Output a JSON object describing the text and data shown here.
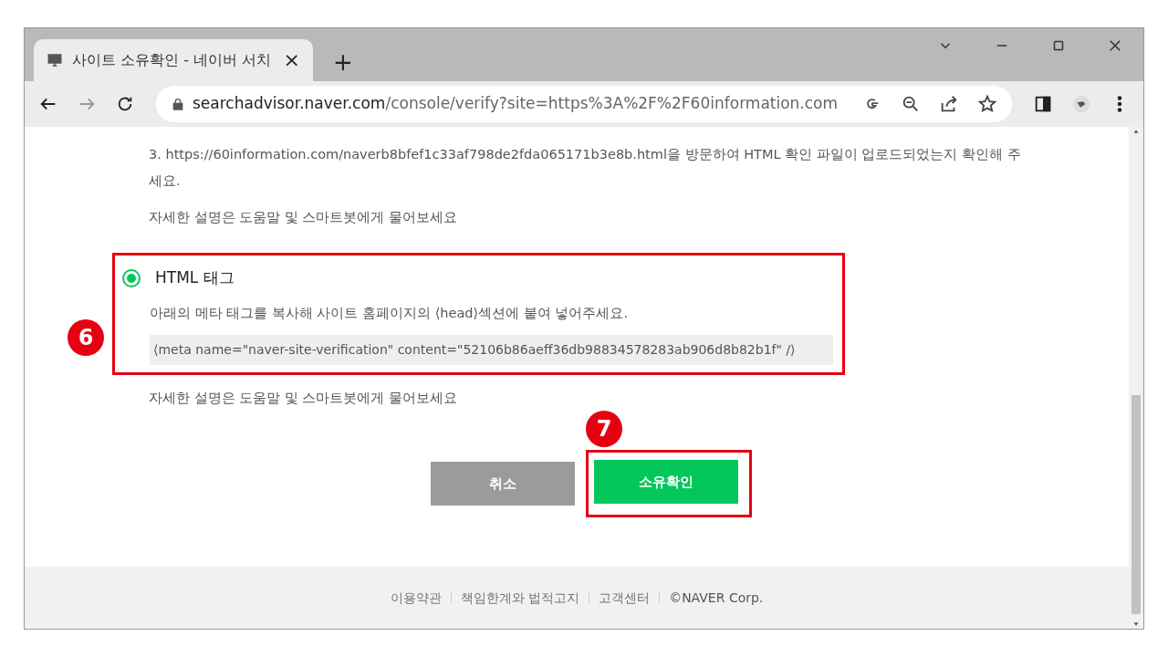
{
  "browser": {
    "tab": {
      "title": "사이트 소유확인 - 네이버 서치",
      "close": "×"
    },
    "new_tab": "+",
    "address": {
      "host": "searchadvisor.naver.com",
      "path": "/console/verify?site=https%3A%2F%2F60information.com"
    },
    "forward_disabled": true
  },
  "step": "3. https://60information.com/naverb8bfef1c33af798de2fda065171b3e8b.html을 방문하여 HTML 확인 파일이 업로드되었는지 확인해 주세요.",
  "help_text_1": "자세한 설명은 도움말 및 스마트봇에게 물어보세요",
  "method": {
    "label": "HTML 태그",
    "selected": true,
    "annotation": "6",
    "description": "아래의 메타 태그를 복사해 사이트 홈페이지의 ⟨head⟩섹션에 붙여 넣어주세요.",
    "code": "⟨meta name=\"naver-site-verification\" content=\"52106b86aeff36db98834578283ab906d8b82b1f\" /⟩"
  },
  "help_text_2": "자세한 설명은 도움말 및 스마트봇에게 물어보세요",
  "buttons": [
    {
      "label": "취소",
      "kind": "cancel"
    },
    {
      "label": "소유확인",
      "kind": "confirm",
      "annotation": "7"
    }
  ],
  "footer": {
    "links": [
      "이용약관",
      "책임한계와 법적고지",
      "고객센터"
    ],
    "copyright": "©NAVER Corp."
  }
}
